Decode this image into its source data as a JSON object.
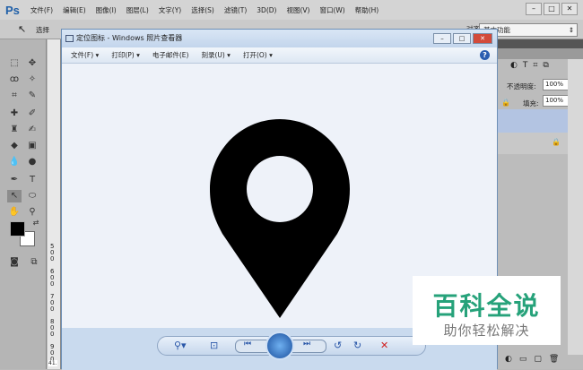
{
  "app": {
    "logo": "Ps",
    "menu": [
      "文件(F)",
      "编辑(E)",
      "图像(I)",
      "图层(L)",
      "文字(Y)",
      "选择(S)",
      "滤镜(T)",
      "3D(D)",
      "视图(V)",
      "窗口(W)",
      "帮助(H)"
    ],
    "window_buttons": [
      "–",
      "□",
      "✕"
    ]
  },
  "options": {
    "select_label": "选择",
    "align_label": "对齐",
    "workspace": "基本功能"
  },
  "ruler": [
    "500",
    "600",
    "700",
    "800",
    "900"
  ],
  "ruler_readout": "41.",
  "viewer": {
    "title": "定位图标 - Windows 照片查看器",
    "menu": [
      "文件(F) ▾",
      "打印(P) ▾",
      "电子邮件(E)",
      "刻录(U) ▾",
      "打开(O) ▾"
    ],
    "help": "?"
  },
  "panel": {
    "opacity_label": "不透明度:",
    "opacity": "100%",
    "fill_label": "填充:",
    "fill": "100%"
  },
  "watermark": {
    "title": "百科全说",
    "subtitle": "助你轻松解决"
  },
  "colors": {
    "accent": "#26a27a",
    "layer_selected": "#b3c4e2"
  }
}
